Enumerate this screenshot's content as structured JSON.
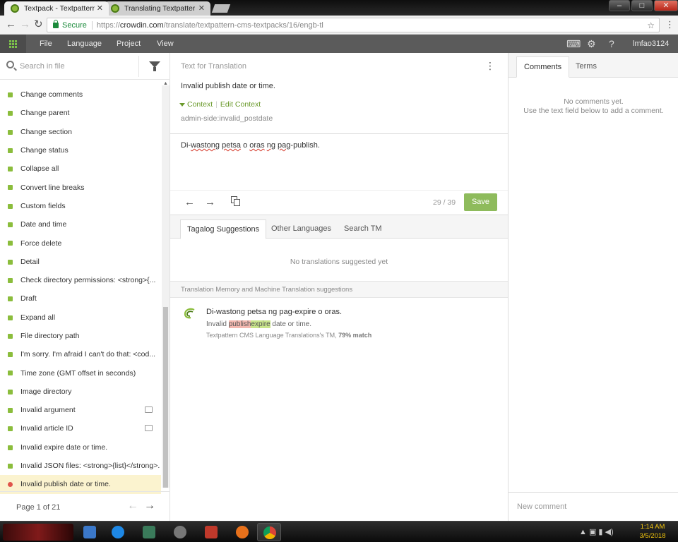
{
  "browser": {
    "tabs": [
      {
        "title": "Textpack - Textpattern C",
        "active": true
      },
      {
        "title": "Translating Textpattern C",
        "active": false
      }
    ],
    "secure_label": "Secure",
    "url_scheme": "https://",
    "url_host": "crowdin.com",
    "url_path": "/translate/textpattern-cms-textpacks/16/engb-tl"
  },
  "app": {
    "menu": [
      "File",
      "Language",
      "Project",
      "View"
    ],
    "username": "lmfao3124",
    "accent": "#8bbd3c"
  },
  "left": {
    "search_placeholder": "Search in file",
    "strings": [
      {
        "label": "Change comments",
        "state": "translated"
      },
      {
        "label": "Change parent",
        "state": "translated"
      },
      {
        "label": "Change section",
        "state": "translated"
      },
      {
        "label": "Change status",
        "state": "translated"
      },
      {
        "label": "Collapse all",
        "state": "translated"
      },
      {
        "label": "Convert line breaks",
        "state": "translated"
      },
      {
        "label": "Custom fields",
        "state": "translated"
      },
      {
        "label": "Date and time",
        "state": "translated"
      },
      {
        "label": "Force delete",
        "state": "translated"
      },
      {
        "label": "Detail",
        "state": "translated"
      },
      {
        "label": "Check directory permissions: <strong>{...",
        "state": "translated"
      },
      {
        "label": "Draft",
        "state": "translated"
      },
      {
        "label": "Expand all",
        "state": "translated"
      },
      {
        "label": "File directory path",
        "state": "translated"
      },
      {
        "label": "I'm sorry. I'm afraid I can't do that: <cod...",
        "state": "translated"
      },
      {
        "label": "Time zone (GMT offset in seconds)",
        "state": "translated"
      },
      {
        "label": "Image directory",
        "state": "translated"
      },
      {
        "label": "Invalid argument",
        "state": "translated",
        "comment": true
      },
      {
        "label": "Invalid article ID",
        "state": "translated",
        "comment": true
      },
      {
        "label": "Invalid expire date or time.",
        "state": "translated"
      },
      {
        "label": "Invalid JSON files: <strong>{list}</strong>.",
        "state": "translated"
      },
      {
        "label": "Invalid publish date or time.",
        "state": "active"
      }
    ],
    "page_label": "Page 1 of 21"
  },
  "editor": {
    "source_header": "Text for Translation",
    "source_text": "Invalid publish date or time.",
    "context_label": "Context",
    "edit_context_label": "Edit Context",
    "string_key": "admin-side:invalid_postdate",
    "translation": {
      "words": [
        "Di-",
        "wastong",
        " ",
        "petsa",
        " o ",
        "oras",
        " ",
        "ng",
        " ",
        "pag",
        "-publish."
      ]
    },
    "counter": "29 / 39",
    "save_label": "Save",
    "tabs": [
      "Tagalog Suggestions",
      "Other Languages",
      "Search TM"
    ],
    "no_suggestions": "No translations suggested yet",
    "tm_header": "Translation Memory and Machine Translation suggestions",
    "tm": {
      "text": "Di-wastong petsa ng pag-expire o oras.",
      "src_pre": "Invalid ",
      "src_del": "publish",
      "src_ins": "expire",
      "src_post": " date or time.",
      "meta_source": "Textpattern CMS Language Translations's TM,",
      "meta_match": "79% match"
    }
  },
  "right": {
    "tabs": [
      "Comments",
      "Terms"
    ],
    "no_comments_line1": "No comments yet.",
    "no_comments_line2": "Use the text field below to add a comment.",
    "new_comment_placeholder": "New comment"
  },
  "taskbar": {
    "time": "1:14 AM",
    "date": "3/5/2018"
  }
}
